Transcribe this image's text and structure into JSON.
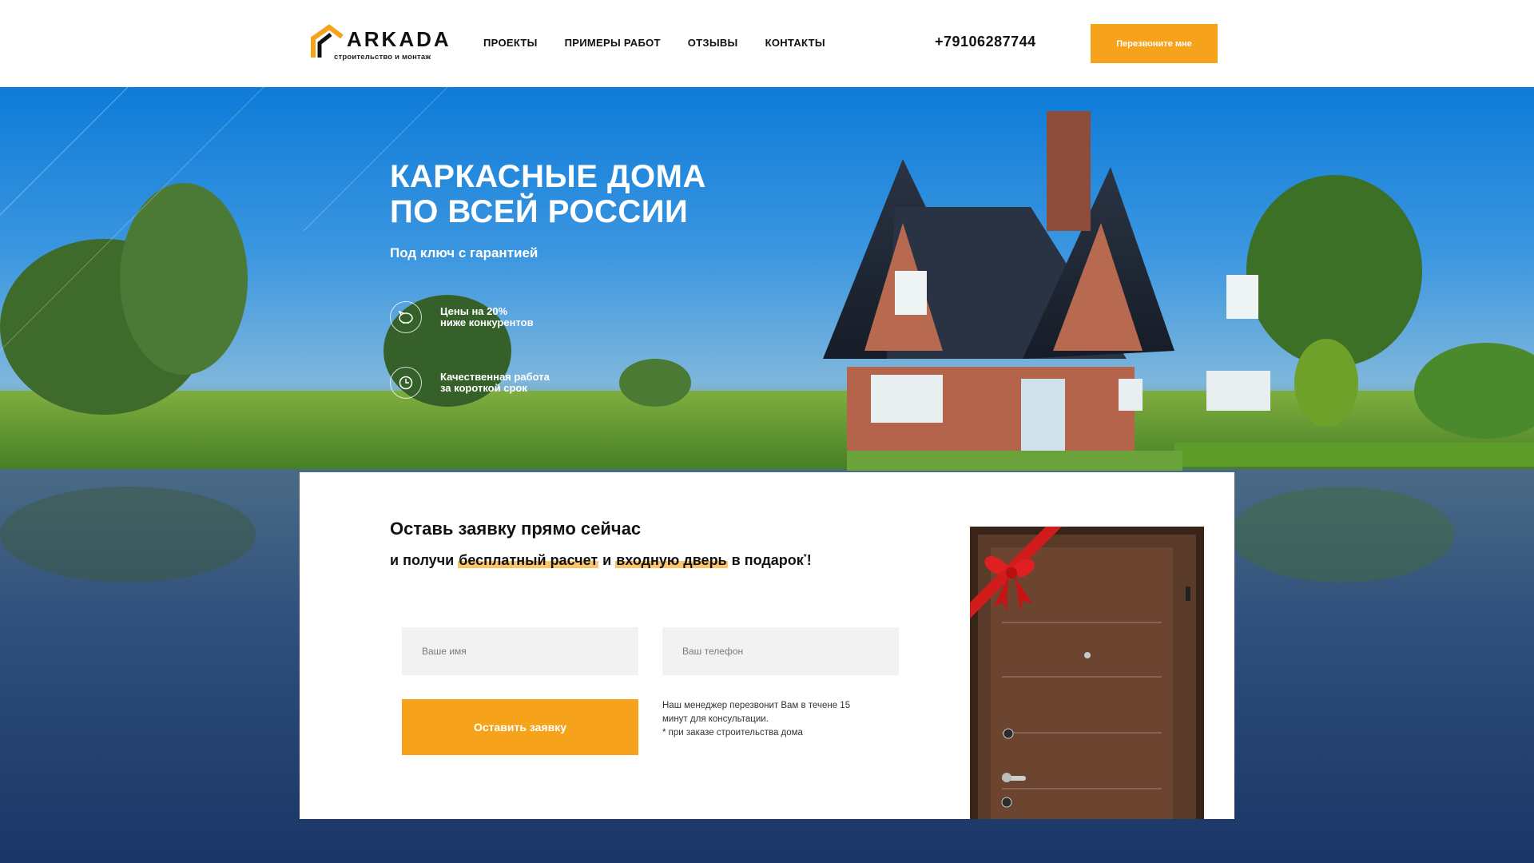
{
  "header": {
    "logo_name": "ARKADA",
    "logo_tagline": "строительство и монтаж",
    "nav": [
      "ПРОЕКТЫ",
      "ПРИМЕРЫ РАБОТ",
      "ОТЗЫВЫ",
      "КОНТАКТЫ"
    ],
    "phone": "+79106287744",
    "callback_label": "Перезвоните мне"
  },
  "hero": {
    "title_line1": "КАРКАСНЫЕ ДОМА",
    "title_line2": "ПО ВСЕЙ РОССИИ",
    "subtitle": "Под ключ с гарантией",
    "features": [
      {
        "icon": "piggy-bank-icon",
        "line1": "Цены на 20%",
        "line2": "ниже конкурентов"
      },
      {
        "icon": "clock-icon",
        "line1": "Качественная работа",
        "line2": "за короткой срок"
      }
    ]
  },
  "form": {
    "title": "Оставь заявку прямо сейчас",
    "sub_prefix": "и получи ",
    "sub_highlight1": "бесплатный расчет",
    "sub_and": " и ",
    "sub_highlight2": "входную дверь",
    "sub_suffix": " в подарок",
    "sub_mark": "*",
    "sub_end": "!",
    "name_placeholder": "Ваше имя",
    "phone_placeholder": "Ваш телефон",
    "submit_label": "Оставить заявку",
    "note_line1": "Наш менеджер перезвонит Вам в течене 15",
    "note_line2": "минут для консультации.",
    "note_line3": "* при заказе строительства дома"
  },
  "colors": {
    "accent": "#f7a21b",
    "highlight": "#fcc46b",
    "footer_bg": "#1a3566"
  }
}
